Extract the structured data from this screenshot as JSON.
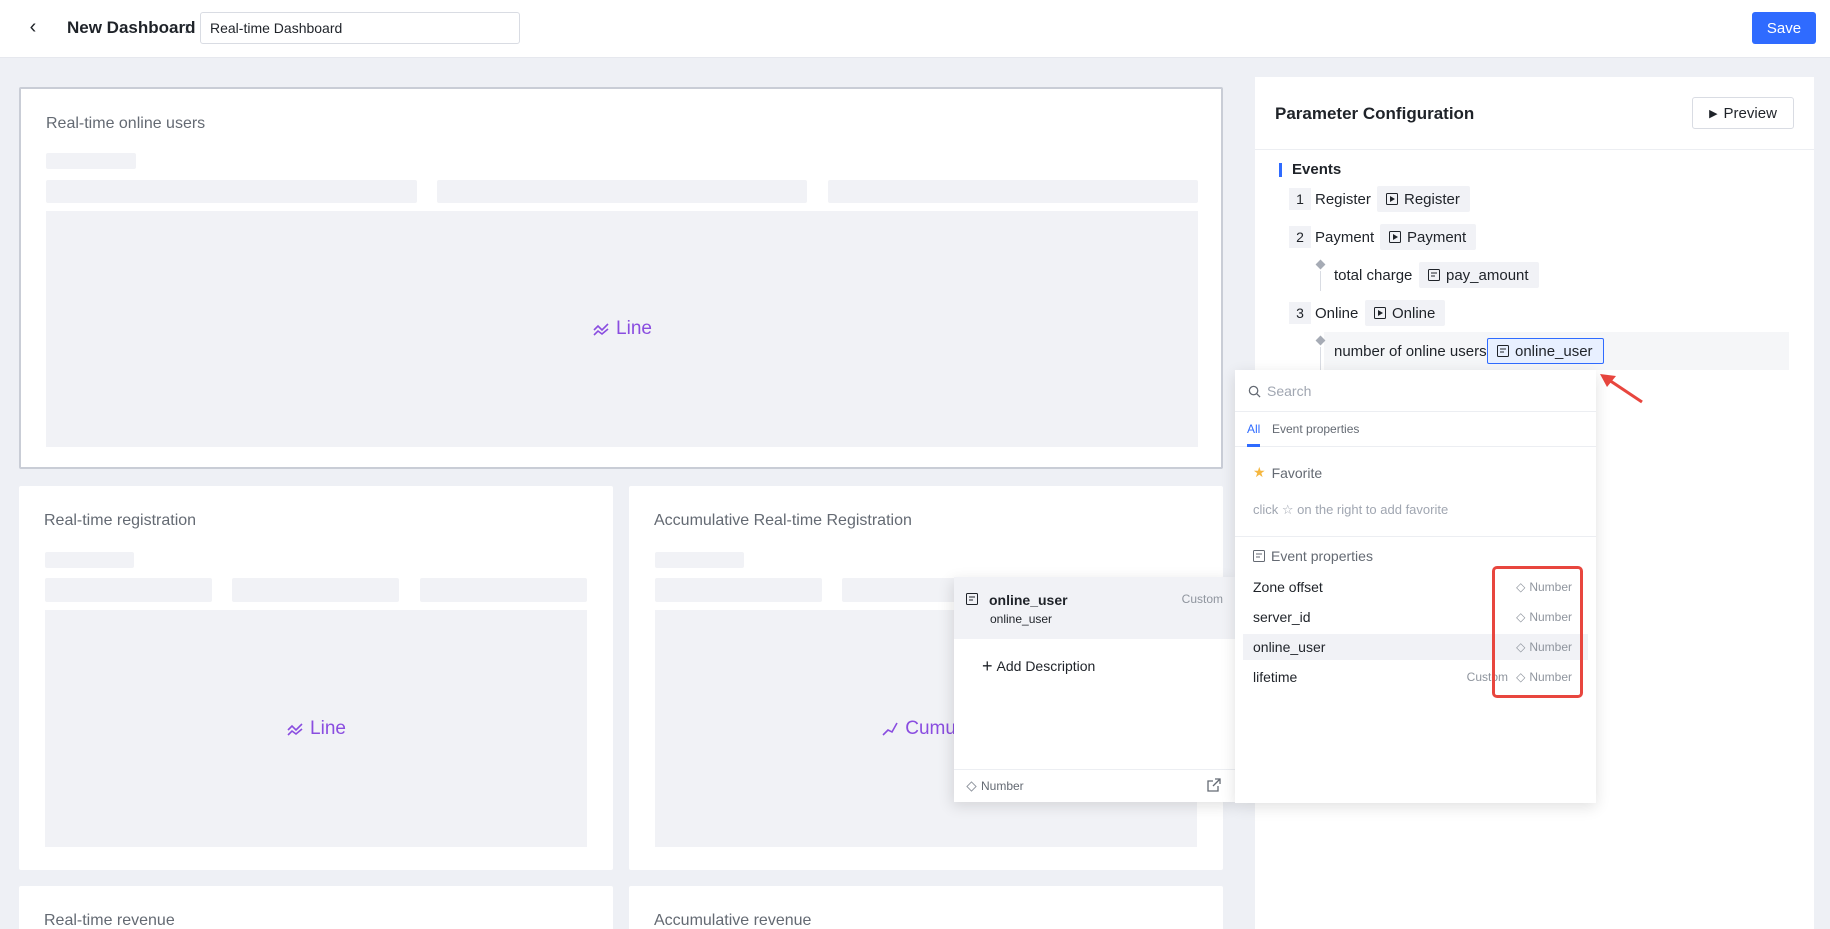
{
  "topbar": {
    "title": "New Dashboard",
    "colon": ":",
    "dashboard_name": "Real-time Dashboard",
    "save_label": "Save"
  },
  "cards": {
    "c1": {
      "title": "Real-time online users",
      "chart": "Line"
    },
    "c2": {
      "title": "Real-time registration",
      "chart": "Line"
    },
    "c3": {
      "title": "Accumulative Real-time Registration",
      "chart": "Cumula"
    },
    "c4": {
      "title": "Real-time revenue"
    },
    "c5": {
      "title": "Accumulative revenue"
    }
  },
  "panel": {
    "title": "Parameter Configuration",
    "preview_label": "Preview",
    "events_label": "Events",
    "events": [
      {
        "num": "1",
        "name": "Register",
        "tag": "Register"
      },
      {
        "num": "2",
        "name": "Payment",
        "tag": "Payment",
        "prop_label": "total charge",
        "prop_tag": "pay_amount"
      },
      {
        "num": "3",
        "name": "Online",
        "tag": "Online",
        "prop_label": "number of online users",
        "prop_tag": "online_user"
      }
    ]
  },
  "dropdown": {
    "search_placeholder": "Search",
    "tabs": [
      "All",
      "Event properties"
    ],
    "favorite_title": "Favorite",
    "favorite_hint": "click ☆ on the right to add favorite",
    "props_title": "Event properties",
    "items": [
      {
        "name": "Zone offset",
        "custom": "",
        "type": "Number"
      },
      {
        "name": "server_id",
        "custom": "",
        "type": "Number"
      },
      {
        "name": "online_user",
        "custom": "",
        "type": "Number"
      },
      {
        "name": "lifetime",
        "custom": "Custom",
        "type": "Number"
      }
    ]
  },
  "detail": {
    "name": "online_user",
    "sub": "online_user",
    "custom": "Custom",
    "add_description": "Add Description",
    "type": "Number"
  },
  "colors": {
    "accent": "#2f6bff",
    "chart_label": "#8a4de0",
    "highlight_box": "#e8463e"
  }
}
